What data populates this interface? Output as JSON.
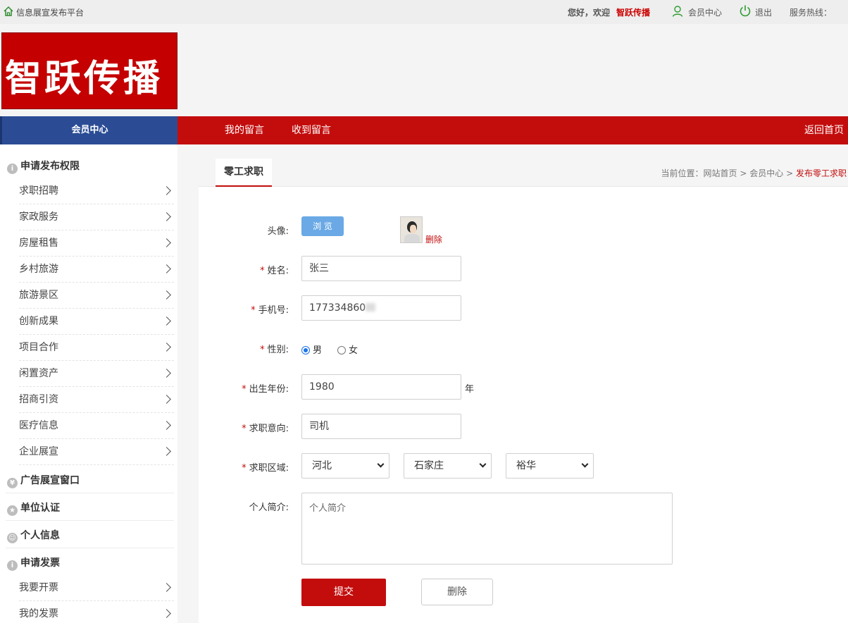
{
  "topbar": {
    "platform": "信息展宣发布平台",
    "greeting": "您好，欢迎",
    "username": "智跃传播",
    "member_center": "会员中心",
    "logout": "退出",
    "hotline": "服务热线："
  },
  "logo": {
    "text": "智跃传播"
  },
  "nav": {
    "member_center": "会员中心",
    "links": [
      "我的留言",
      "收到留言"
    ],
    "home": "返回首页"
  },
  "sidebar": {
    "sections": [
      {
        "title": "申请发布权限",
        "icon": "info-icon",
        "items": [
          "求职招聘",
          "家政服务",
          "房屋租售",
          "乡村旅游",
          "旅游景区",
          "创新成果",
          "项目合作",
          "闲置资产",
          "招商引资",
          "医疗信息",
          "企业展宣"
        ]
      },
      {
        "title": "广告展宣窗口",
        "icon": "yen-icon",
        "items": []
      },
      {
        "title": "单位认证",
        "icon": "star-icon",
        "items": []
      },
      {
        "title": "个人信息",
        "icon": "user-icon",
        "items": []
      },
      {
        "title": "申请发票",
        "icon": "info-icon",
        "items": [
          "我要开票",
          "我的发票"
        ]
      }
    ]
  },
  "main": {
    "tab": "零工求职",
    "breadcrumb": {
      "prefix": "当前位置：",
      "home": "网站首页",
      "sep": ">",
      "member": "会员中心",
      "current": "发布零工求职"
    },
    "form": {
      "avatar_label": "头像:",
      "browse": "浏 览",
      "avatar_delete": "删除",
      "name_label": "姓名:",
      "name_value": "张三",
      "phone_label": "手机号:",
      "phone_value": "17733486",
      "phone_suffix": "0",
      "gender_label": "性别:",
      "gender_male": "男",
      "gender_female": "女",
      "gender_selected": "男",
      "birth_label": "出生年份:",
      "birth_value": "1980",
      "birth_unit": "年",
      "intent_label": "求职意向:",
      "intent_value": "司机",
      "region_label": "求职区域:",
      "province": "河北",
      "city": "石家庄",
      "district": "裕华",
      "intro_label": "个人简介:",
      "intro_placeholder": "个人简介",
      "submit": "提交",
      "delete": "删除"
    }
  },
  "colors": {
    "brand_red": "#c30d0d",
    "nav_blue": "#2b4c95",
    "browse_blue": "#6aa9e6"
  }
}
